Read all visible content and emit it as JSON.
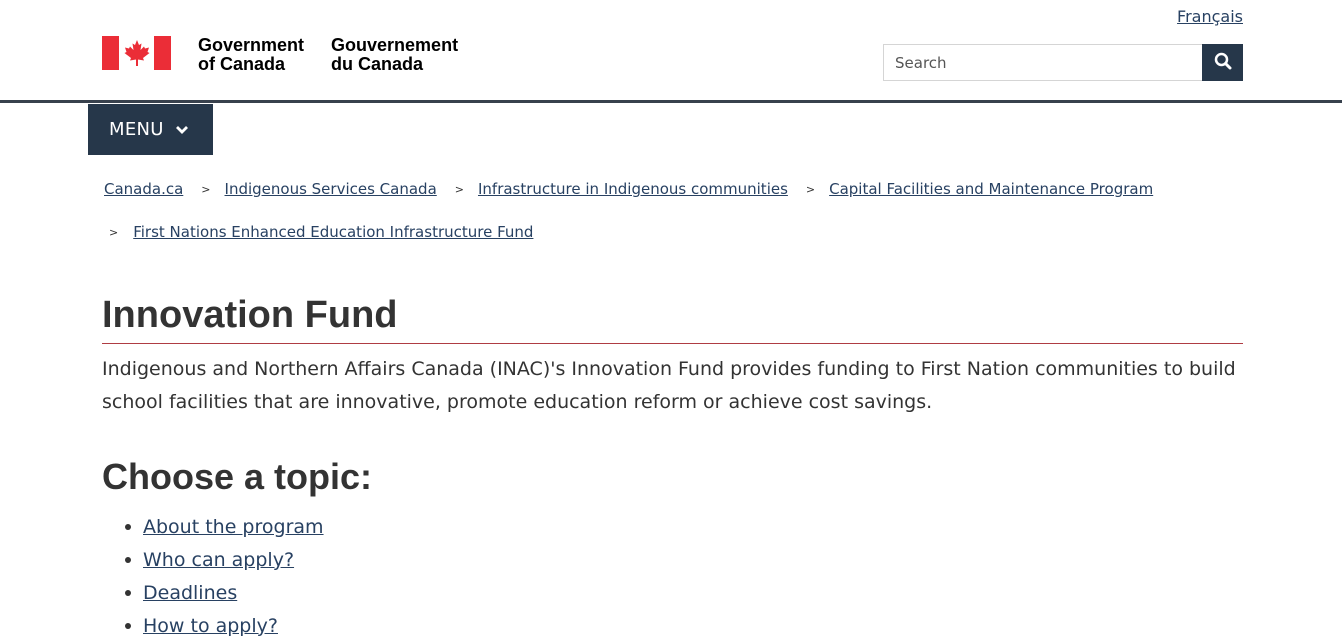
{
  "header": {
    "language_link": "Français",
    "wordmark_en": "Government\nof Canada",
    "wordmark_fr": "Gouvernement\ndu Canada",
    "search_placeholder": "Search",
    "flag_color": "#eb2d37"
  },
  "menu": {
    "label": "MENU"
  },
  "breadcrumb": {
    "separator": ">",
    "items": [
      "Canada.ca",
      "Indigenous Services Canada",
      "Infrastructure in Indigenous communities",
      "Capital Facilities and Maintenance Program",
      "First Nations Enhanced Education Infrastructure Fund"
    ]
  },
  "main": {
    "title": "Innovation Fund",
    "intro": "Indigenous and Northern Affairs Canada (INAC)'s Innovation Fund provides funding to First Nation communities to build school facilities that are innovative, promote education reform or achieve cost savings.",
    "topics_heading": "Choose a topic:",
    "topics": [
      "About the program",
      "Who can apply?",
      "Deadlines",
      "How to apply?"
    ]
  },
  "colors": {
    "nav_dark": "#26374a",
    "link": "#284162",
    "title_rule": "#af3c43"
  }
}
